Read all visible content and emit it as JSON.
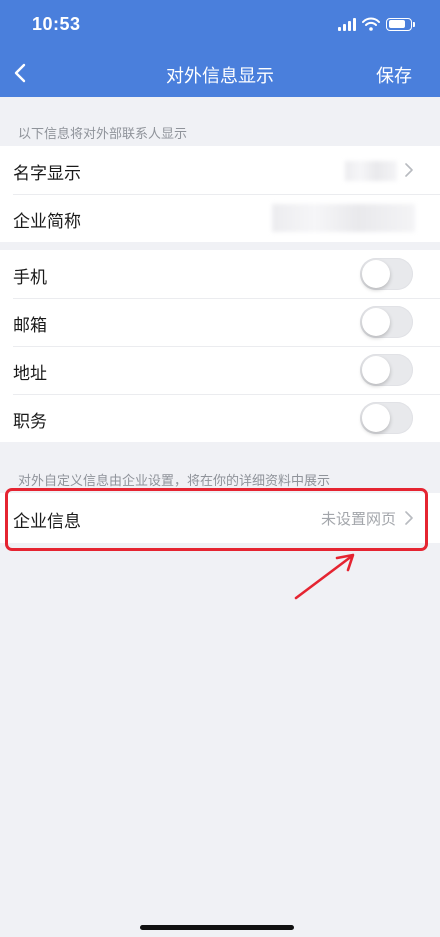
{
  "status_bar": {
    "time": "10:53"
  },
  "nav": {
    "title": "对外信息显示",
    "save": "保存",
    "back_icon": "chevron-left-icon"
  },
  "section1": {
    "hint": "以下信息将对外部联系人显示",
    "rows": [
      {
        "label": "名字显示"
      },
      {
        "label": "企业简称"
      }
    ]
  },
  "section2": {
    "rows": [
      {
        "label": "手机",
        "enabled": false
      },
      {
        "label": "邮箱",
        "enabled": false
      },
      {
        "label": "地址",
        "enabled": false
      },
      {
        "label": "职务",
        "enabled": false
      }
    ]
  },
  "section3": {
    "hint": "对外自定义信息由企业设置，将在你的详细资料中展示",
    "row": {
      "label": "企业信息",
      "value": "未设置网页"
    }
  },
  "colors": {
    "header": "#4a7fdc",
    "annotation": "#e52431",
    "background": "#f0f1f5"
  }
}
